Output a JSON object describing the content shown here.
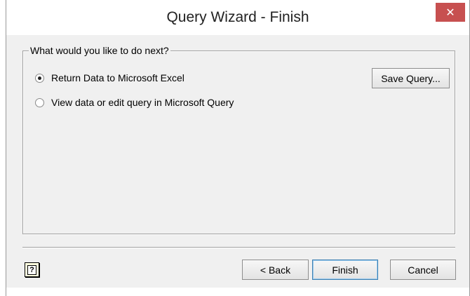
{
  "window": {
    "title": "Query Wizard - Finish",
    "close_label": "✕"
  },
  "group": {
    "legend": "What would you like to do next?",
    "options": [
      {
        "label": "Return Data to Microsoft Excel",
        "selected": true
      },
      {
        "label": "View data or edit query in Microsoft Query",
        "selected": false
      }
    ]
  },
  "buttons": {
    "save_query": "Save Query...",
    "back": "< Back",
    "finish": "Finish",
    "cancel": "Cancel",
    "help": "?"
  },
  "icons": {
    "close": "close-icon",
    "help": "help-icon"
  },
  "colors": {
    "close_button": "#c75050",
    "dialog_background": "#f0f0f0",
    "default_button_border": "#3c7fb1"
  }
}
